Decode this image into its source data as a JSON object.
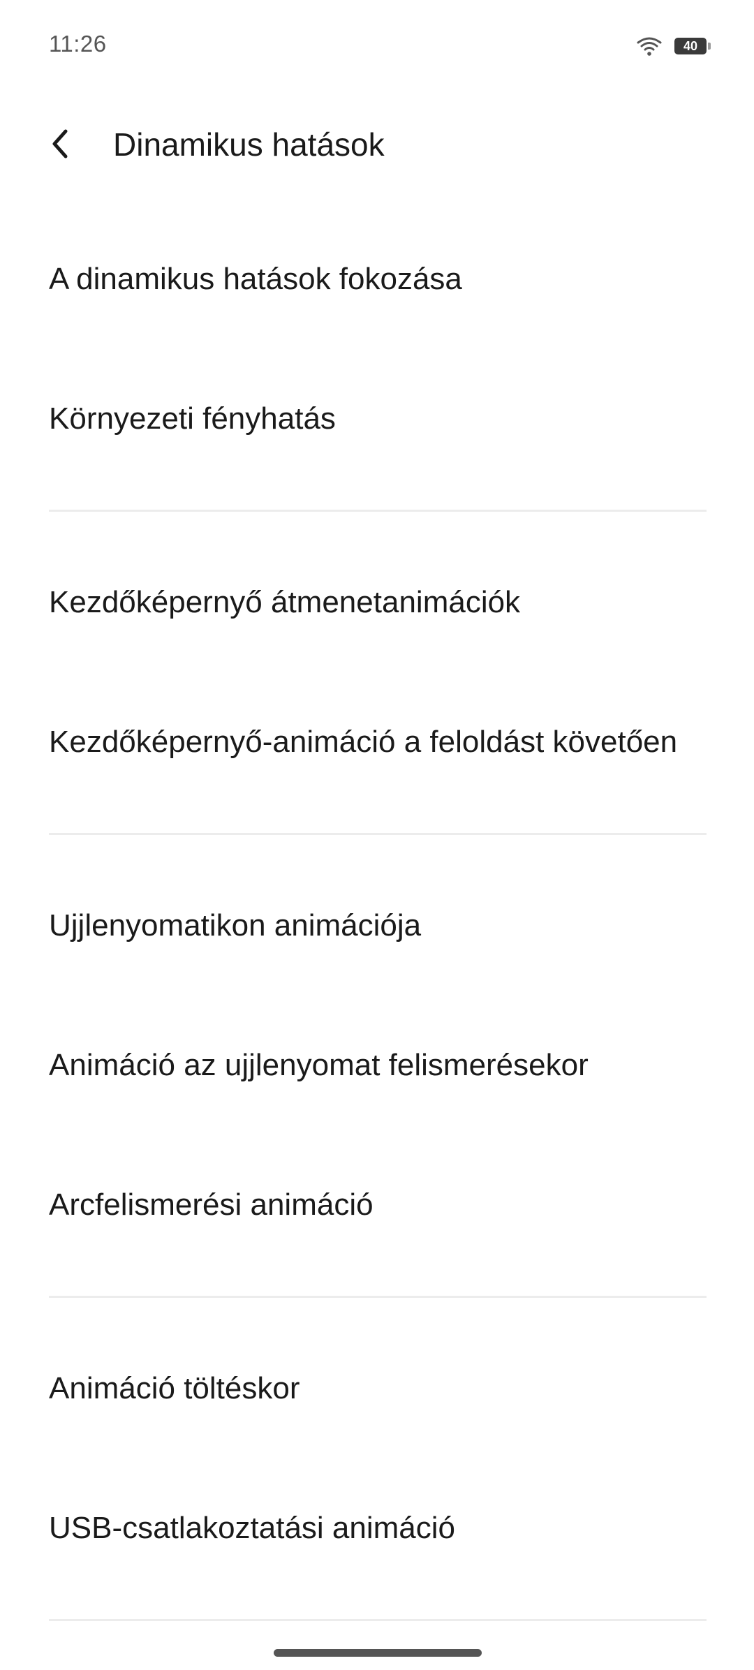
{
  "status_bar": {
    "time": "11:26",
    "battery_level": "40",
    "icons": [
      "wifi-icon",
      "battery-icon"
    ]
  },
  "header": {
    "title": "Dinamikus hatások",
    "back_icon": "chevron-left-icon"
  },
  "groups": [
    {
      "items": [
        {
          "label": "A dinamikus hatások fokozása"
        },
        {
          "label": "Környezeti fényhatás"
        }
      ]
    },
    {
      "items": [
        {
          "label": "Kezdőképernyő átmenetanimációk"
        },
        {
          "label": "Kezdőképernyő-animáció a feloldást követően"
        }
      ]
    },
    {
      "items": [
        {
          "label": "Ujjlenyomatikon animációja"
        },
        {
          "label": "Animáció az ujjlenyomat felismerésekor"
        },
        {
          "label": "Arcfelismerési animáció"
        }
      ]
    },
    {
      "items": [
        {
          "label": "Animáció töltéskor"
        },
        {
          "label": "USB-csatlakoztatási animáció"
        }
      ]
    }
  ],
  "colors": {
    "background": "#ffffff",
    "text": "#1a1a1a",
    "divider": "#ececec",
    "status_text": "#555555"
  }
}
